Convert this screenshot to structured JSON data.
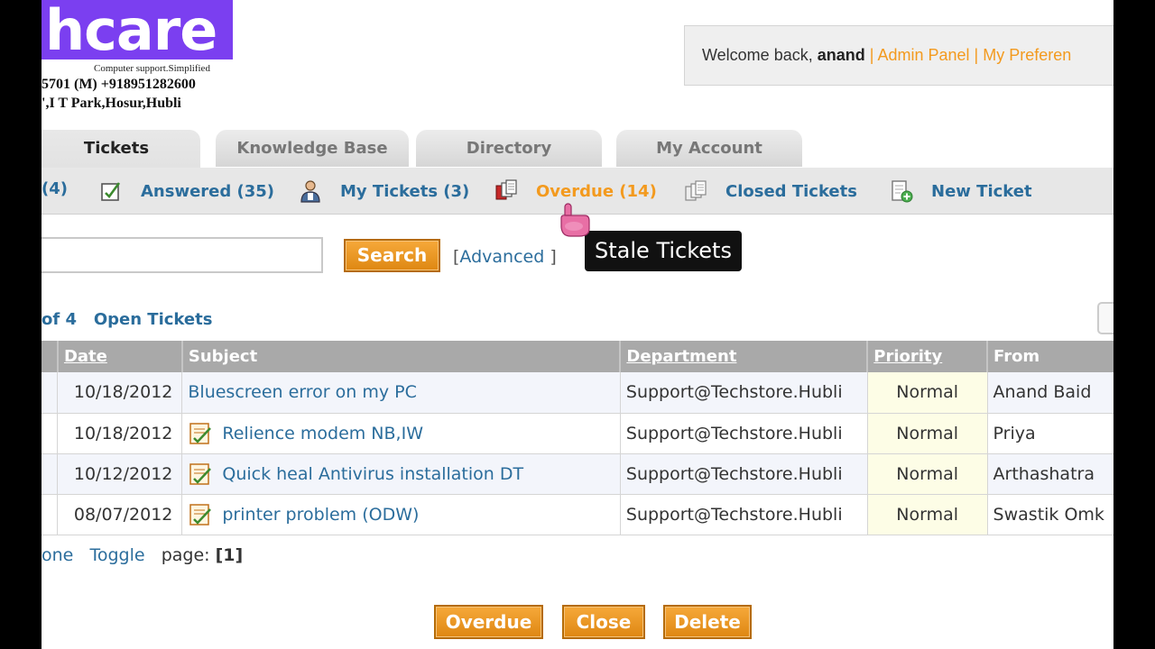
{
  "header": {
    "logo_text": "hcare",
    "tagline": "Computer support.Simplified",
    "phone": "5701 (M) +918951282600",
    "address": "',I T Park,Hosur,Hubli",
    "welcome_prefix": "Welcome back,",
    "username": "anand",
    "separator": "|",
    "admin_panel": "Admin Panel",
    "preferences": "My Preferen"
  },
  "tabs": [
    {
      "label": "Tickets",
      "active": true
    },
    {
      "label": "Knowledge Base",
      "active": false
    },
    {
      "label": "Directory",
      "active": false
    },
    {
      "label": "My Account",
      "active": false
    }
  ],
  "subnav": {
    "open": "(4)",
    "answered": "Answered (35)",
    "my_tickets": "My Tickets (3)",
    "overdue": "Overdue (14)",
    "closed": "Closed Tickets",
    "new_ticket": "New Ticket"
  },
  "search": {
    "value": "",
    "button": "Search",
    "advanced_open": "[",
    "advanced": "Advanced",
    "advanced_close": " ]"
  },
  "tooltip": "Stale Tickets",
  "listing": {
    "title_count": "of 4",
    "title": "Open Tickets"
  },
  "table": {
    "headers": {
      "date": "Date",
      "subject": "Subject",
      "department": "Department",
      "priority": "Priority",
      "from": "From"
    },
    "rows": [
      {
        "date": "10/18/2012",
        "subject": "Bluescreen error on my PC",
        "has_note": false,
        "department": "Support@Techstore.Hubli",
        "priority": "Normal",
        "from": "Anand Baid"
      },
      {
        "date": "10/18/2012",
        "subject": "Relience modem NB,IW",
        "has_note": true,
        "department": "Support@Techstore.Hubli",
        "priority": "Normal",
        "from": "Priya"
      },
      {
        "date": "10/12/2012",
        "subject": "Quick heal Antivirus installation DT",
        "has_note": true,
        "department": "Support@Techstore.Hubli",
        "priority": "Normal",
        "from": "Arthashatra"
      },
      {
        "date": "08/07/2012",
        "subject": "printer problem (ODW)",
        "has_note": true,
        "department": "Support@Techstore.Hubli",
        "priority": "Normal",
        "from": "Swastik Omk"
      }
    ]
  },
  "footer": {
    "none": "one",
    "toggle": "Toggle",
    "page_label": "page:",
    "page_current": "[1]"
  },
  "actions": {
    "overdue": "Overdue",
    "close": "Close",
    "delete": "Delete"
  },
  "colors": {
    "logo_bg": "#7b3ff0",
    "link_blue": "#2b6d9c",
    "accent_orange": "#f39a1e",
    "header_gray": "#a9a9a9"
  }
}
